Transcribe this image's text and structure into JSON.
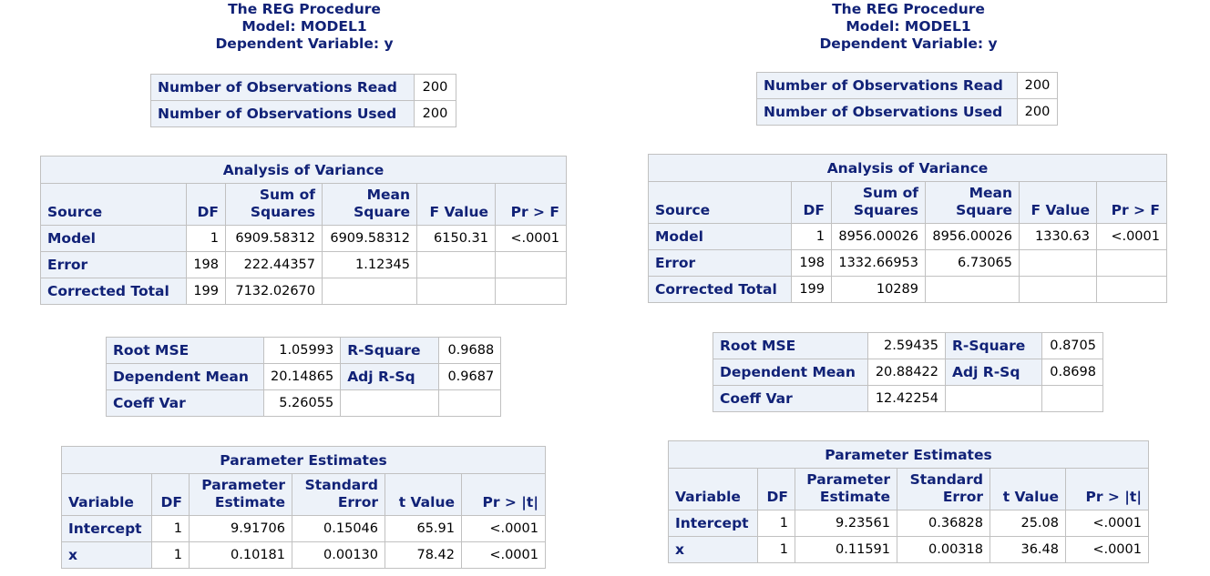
{
  "outputs": [
    {
      "header": {
        "procedure": "The REG Procedure",
        "model": "Model: MODEL1",
        "dependent": "Dependent Variable: y"
      },
      "observations": [
        {
          "label": "Number of Observations Read",
          "value": "200"
        },
        {
          "label": "Number of Observations Used",
          "value": "200"
        }
      ],
      "anova": {
        "caption": "Analysis of Variance",
        "columns": [
          "Source",
          "DF",
          "Sum of\nSquares",
          "Mean\nSquare",
          "F Value",
          "Pr > F"
        ],
        "rows": [
          {
            "source": "Model",
            "df": "1",
            "ss": "6909.58312",
            "ms": "6909.58312",
            "f": "6150.31",
            "p": "<.0001"
          },
          {
            "source": "Error",
            "df": "198",
            "ss": "222.44357",
            "ms": "1.12345",
            "f": "",
            "p": ""
          },
          {
            "source": "Corrected Total",
            "df": "199",
            "ss": "7132.02670",
            "ms": "",
            "f": "",
            "p": ""
          }
        ]
      },
      "fit": [
        {
          "label1": "Root MSE",
          "value1": "1.05993",
          "label2": "R-Square",
          "value2": "0.9688"
        },
        {
          "label1": "Dependent Mean",
          "value1": "20.14865",
          "label2": "Adj R-Sq",
          "value2": "0.9687"
        },
        {
          "label1": "Coeff Var",
          "value1": "5.26055",
          "label2": "",
          "value2": ""
        }
      ],
      "params": {
        "caption": "Parameter Estimates",
        "columns": [
          "Variable",
          "DF",
          "Parameter\nEstimate",
          "Standard\nError",
          "t Value",
          "Pr > |t|"
        ],
        "rows": [
          {
            "variable": "Intercept",
            "df": "1",
            "estimate": "9.91706",
            "se": "0.15046",
            "t": "65.91",
            "p": "<.0001"
          },
          {
            "variable": "x",
            "df": "1",
            "estimate": "0.10181",
            "se": "0.00130",
            "t": "78.42",
            "p": "<.0001"
          }
        ]
      }
    },
    {
      "header": {
        "procedure": "The REG Procedure",
        "model": "Model: MODEL1",
        "dependent": "Dependent Variable: y"
      },
      "observations": [
        {
          "label": "Number of Observations Read",
          "value": "200"
        },
        {
          "label": "Number of Observations Used",
          "value": "200"
        }
      ],
      "anova": {
        "caption": "Analysis of Variance",
        "columns": [
          "Source",
          "DF",
          "Sum of\nSquares",
          "Mean\nSquare",
          "F Value",
          "Pr > F"
        ],
        "rows": [
          {
            "source": "Model",
            "df": "1",
            "ss": "8956.00026",
            "ms": "8956.00026",
            "f": "1330.63",
            "p": "<.0001"
          },
          {
            "source": "Error",
            "df": "198",
            "ss": "1332.66953",
            "ms": "6.73065",
            "f": "",
            "p": ""
          },
          {
            "source": "Corrected Total",
            "df": "199",
            "ss": "10289",
            "ms": "",
            "f": "",
            "p": ""
          }
        ]
      },
      "fit": [
        {
          "label1": "Root MSE",
          "value1": "2.59435",
          "label2": "R-Square",
          "value2": "0.8705"
        },
        {
          "label1": "Dependent Mean",
          "value1": "20.88422",
          "label2": "Adj R-Sq",
          "value2": "0.8698"
        },
        {
          "label1": "Coeff Var",
          "value1": "12.42254",
          "label2": "",
          "value2": ""
        }
      ],
      "params": {
        "caption": "Parameter Estimates",
        "columns": [
          "Variable",
          "DF",
          "Parameter\nEstimate",
          "Standard\nError",
          "t Value",
          "Pr > |t|"
        ],
        "rows": [
          {
            "variable": "Intercept",
            "df": "1",
            "estimate": "9.23561",
            "se": "0.36828",
            "t": "25.08",
            "p": "<.0001"
          },
          {
            "variable": "x",
            "df": "1",
            "estimate": "0.11591",
            "se": "0.00318",
            "t": "36.48",
            "p": "<.0001"
          }
        ]
      }
    }
  ]
}
